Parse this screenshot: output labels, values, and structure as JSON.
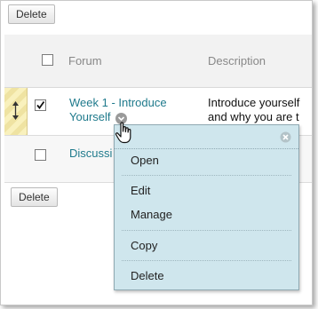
{
  "toolbar": {
    "delete_top": "Delete",
    "delete_bottom": "Delete"
  },
  "table": {
    "columns": {
      "forum": "Forum",
      "description": "Description"
    },
    "rows": [
      {
        "forum_line1": "Week 1 - Introduce",
        "forum_line2": "Yourself",
        "desc_line1": "Introduce yourself",
        "desc_line2": "and why you are t",
        "checked": true
      },
      {
        "forum_line1": "Discussi",
        "checked": false
      }
    ]
  },
  "context_menu": {
    "items": [
      "Open",
      "Edit",
      "Manage",
      "Copy",
      "Delete"
    ]
  },
  "icons": [
    "drag-handle-icon",
    "chevron-down-icon",
    "close-icon",
    "hand-cursor-icon",
    "checkmark-icon"
  ],
  "colors": {
    "link": "#1f7a8c",
    "menu_bg": "#cfe6ed",
    "header_bg": "#f2f2f2"
  }
}
